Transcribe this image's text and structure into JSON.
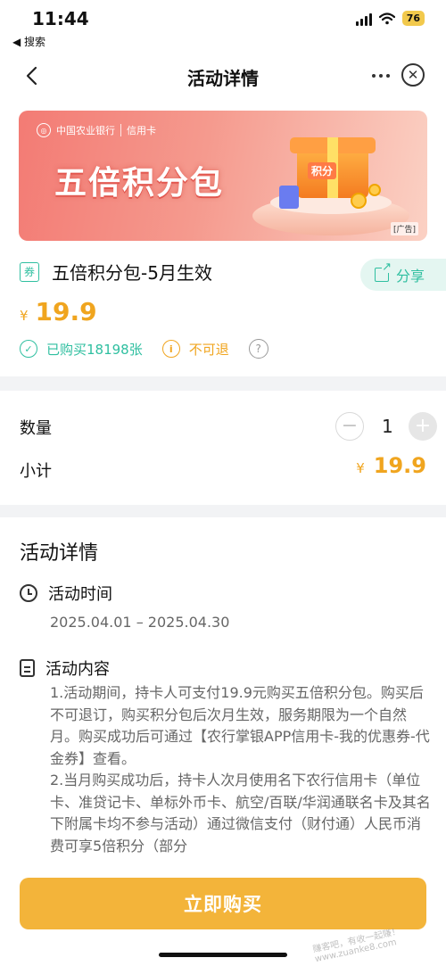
{
  "status_bar": {
    "time": "11:44",
    "back_app": "◀ 搜索",
    "battery": "76"
  },
  "nav": {
    "title": "活动详情"
  },
  "banner": {
    "bank_name": "中国农业银行",
    "card_type": "信用卡",
    "title": "五倍积分包",
    "gift_label": "积分",
    "ad_label": "[广告]"
  },
  "product": {
    "coupon_icon": "券",
    "title": "五倍积分包-5月生效",
    "share_label": "分享",
    "currency": "¥",
    "price": "19.9",
    "tags": {
      "purchased": "已购买18198张",
      "no_refund": "不可退"
    }
  },
  "order": {
    "quantity_label": "数量",
    "quantity": "1",
    "subtotal_label": "小计",
    "currency": "¥",
    "subtotal": "19.9"
  },
  "details": {
    "section_title": "活动详情",
    "time_heading": "活动时间",
    "date_range": "2025.04.01 – 2025.04.30",
    "content_heading": "活动内容",
    "content_text": "1.活动期间，持卡人可支付19.9元购买五倍积分包。购买后不可退订，购买积分包后次月生效，服务期限为一个自然月。购买成功后可通过【农行掌银APP信用卡-我的优惠券-代金券】查看。\n2.当月购买成功后，持卡人次月使用名下农行信用卡（单位卡、准贷记卡、单标外币卡、航空/百联/华润通联名卡及其名下附属卡均不参与活动）通过微信支付（财付通）人民币消费可享5倍积分（部分"
  },
  "buy_button": "立即购买",
  "watermark": "赚客吧，有收一起赚！www.zuanke8.com",
  "colors": {
    "accent": "#f3b43a",
    "price": "#f0a51f",
    "teal": "#2fbfa0"
  }
}
